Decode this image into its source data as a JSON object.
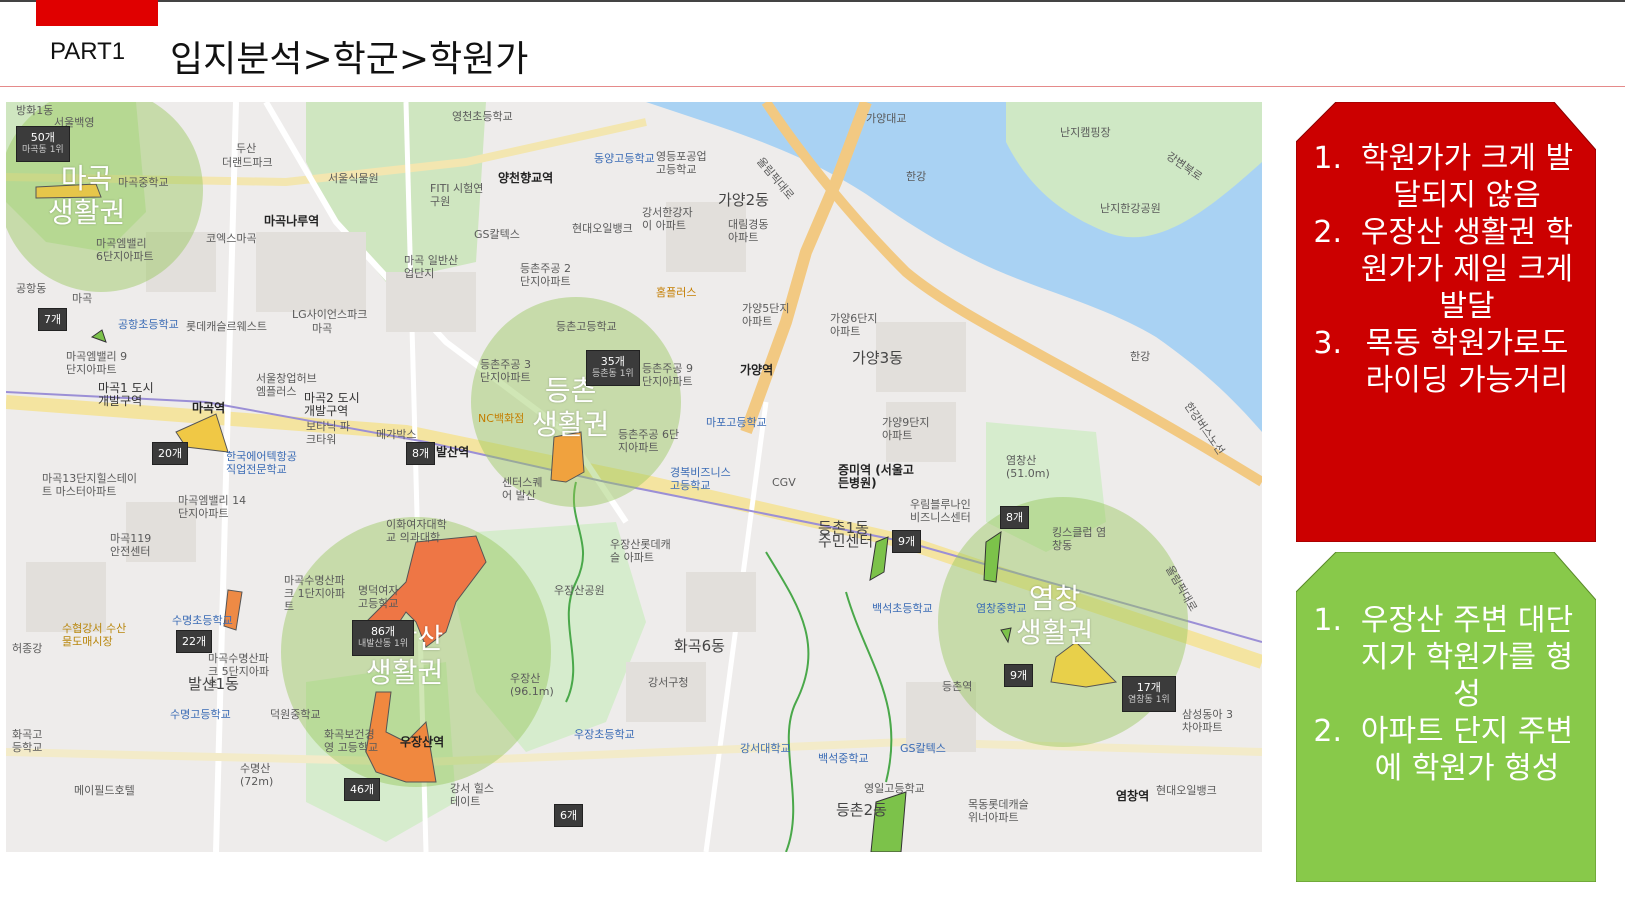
{
  "header": {
    "part": "PART1",
    "title": "입지분석>학군>학원가"
  },
  "map": {
    "zones": [
      {
        "name": "마곡\n생활권"
      },
      {
        "name": "등촌\n생활권"
      },
      {
        "name": "우장산\n생활권"
      },
      {
        "name": "염창\n생활권"
      }
    ],
    "counts": [
      {
        "value": "50개",
        "sub": "마곡동 1위"
      },
      {
        "value": "7개"
      },
      {
        "value": "20개"
      },
      {
        "value": "8개"
      },
      {
        "value": "35개",
        "sub": "등촌동 1위"
      },
      {
        "value": "86개",
        "sub": "내발산동 1위"
      },
      {
        "value": "22개"
      },
      {
        "value": "46개"
      },
      {
        "value": "6개"
      },
      {
        "value": "9개"
      },
      {
        "value": "8개"
      },
      {
        "value": "9개"
      },
      {
        "value": "17개",
        "sub": "염창동 1위"
      }
    ],
    "places": [
      "방화1동",
      "서울백영",
      "두산",
      "더랜드파크",
      "마곡중학교",
      "서울식물원",
      "마곡나루역",
      "코엑스마곡",
      "마곡엠밸리 6단지아파트",
      "공항동",
      "마곡",
      "롯데캐슬르웨스트",
      "LG사이언스파크",
      "마곡",
      "공항초등학교",
      "마곡엠밸리 9단지아파트",
      "서울창업허브 엠플러스",
      "마곡1 도시개발구역",
      "마곡2 도시개발구역",
      "보타닉 파크타워",
      "메가박스",
      "마곡역",
      "한국에어텍항공 직업전문학교",
      "마곡13단지힐스테이트 마스터아파트",
      "마곡엠밸리 14단지아파트",
      "마곡119 안전센터",
      "발산역",
      "이화여자대학교 의과대학",
      "마곡수명산파크 1단지아파트",
      "명덕여자고등학교",
      "수명초등학교",
      "수협강서 수산물도매시장",
      "마곡수명산파크 5단지아파트",
      "발산1동",
      "수명고등학교",
      "덕원중학교",
      "화곡보건경영 고등학교",
      "우장산역",
      "수명산 (72m)",
      "메이필드호텔",
      "강서 힐스테이트",
      "영천초등학교",
      "양천향교역",
      "FITI 시험연구원",
      "마곡 일반산업단지",
      "GS칼텍스",
      "동양고등학교",
      "영등포공업 고등학교",
      "현대오일뱅크",
      "강서한강자이 아파트",
      "가양2동",
      "대림경동 아파트",
      "등촌주공 2단지아파트",
      "홈플러스",
      "등촌고등학교",
      "등촌주공 3단지아파트",
      "등촌주공 9단지아파트",
      "NC백화점",
      "가양역",
      "가양5단지 아파트",
      "가양6단지 아파트",
      "가양3동",
      "마포고등학교",
      "등촌주공 6단지아파트",
      "경복비즈니스 고등학교",
      "CGV",
      "증미역 (서울고든병원)",
      "가양9단지 아파트",
      "우림블루나인 비즈니스센터",
      "센터스퀘어 발산",
      "우장산롯데캐슬 아파트",
      "우장산공원",
      "등촌1동 주민센터",
      "백석초등학교",
      "화곡6동",
      "강서구청",
      "우장산 (96.1m)",
      "우장초등학교",
      "강서대학교",
      "백석중학교",
      "GS칼텍스",
      "영일고등학교",
      "등촌2동",
      "목동롯데캐슬 위너아파트",
      "가양대교",
      "한강",
      "난지캠핑장",
      "난지한강공원",
      "강변북로",
      "올림픽대로",
      "염창산 (51.0m)",
      "킹스클럽 염창동",
      "염창중학교",
      "염창역",
      "현대오일뱅크",
      "등촌역",
      "삼성동아 3차아파트",
      "한강",
      "한강버스노선",
      "올림픽대로",
      "화곡고 등학교",
      "허종강"
    ]
  },
  "notes": {
    "red": {
      "color": "#cc0000",
      "items": [
        {
          "num": "1.",
          "text": "학원가가 크게 발달되지 않음"
        },
        {
          "num": "2.",
          "text": "우장산 생활권 학원가가 제일 크게 발달"
        },
        {
          "num": "3.",
          "text": "목동 학원가로도 라이딩 가능거리"
        }
      ]
    },
    "green": {
      "color": "#88c94a",
      "items": [
        {
          "num": "1.",
          "text": "우장산 주변 대단지가 학원가를 형성"
        },
        {
          "num": "2.",
          "text": "아파트 단지 주변에 학원가 형성"
        }
      ]
    }
  }
}
